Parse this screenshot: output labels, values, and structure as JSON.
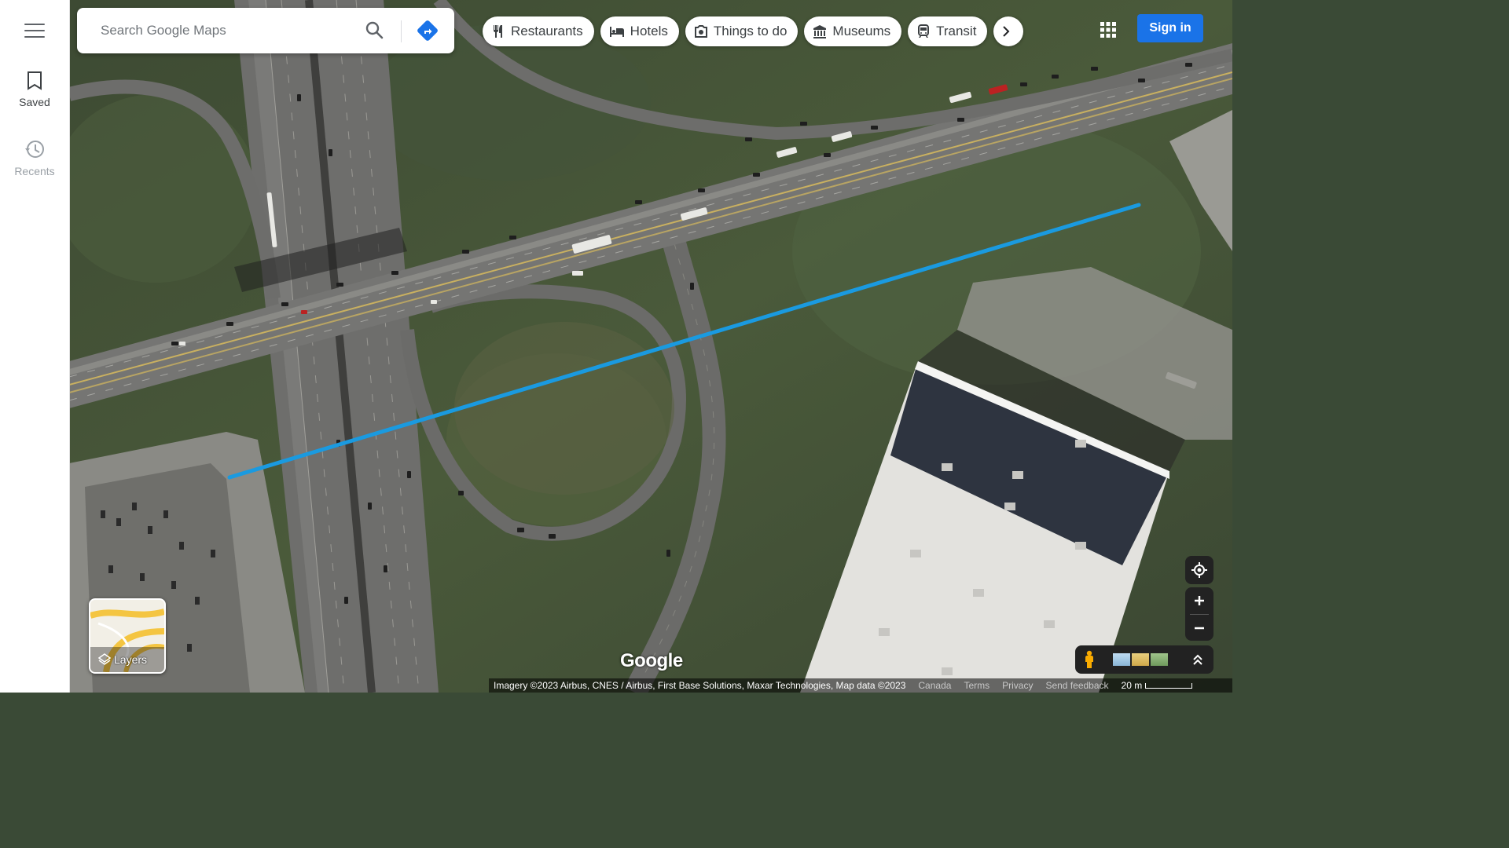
{
  "rail": {
    "saved_label": "Saved",
    "recents_label": "Recents"
  },
  "search": {
    "placeholder": "Search Google Maps"
  },
  "chips": [
    {
      "label": "Restaurants",
      "icon": "fork-knife-icon"
    },
    {
      "label": "Hotels",
      "icon": "bed-icon"
    },
    {
      "label": "Things to do",
      "icon": "camera-icon"
    },
    {
      "label": "Museums",
      "icon": "museum-icon"
    },
    {
      "label": "Transit",
      "icon": "train-icon"
    }
  ],
  "header": {
    "signin_label": "Sign in"
  },
  "layers": {
    "label": "Layers"
  },
  "map": {
    "logo": "Google",
    "route_color": "#1a9ae0"
  },
  "footer": {
    "imagery": "Imagery ©2023 Airbus, CNES / Airbus, First Base Solutions, Maxar Technologies, Map data ©2023",
    "country": "Canada",
    "terms": "Terms",
    "privacy": "Privacy",
    "feedback": "Send feedback",
    "scale": "20 m"
  }
}
